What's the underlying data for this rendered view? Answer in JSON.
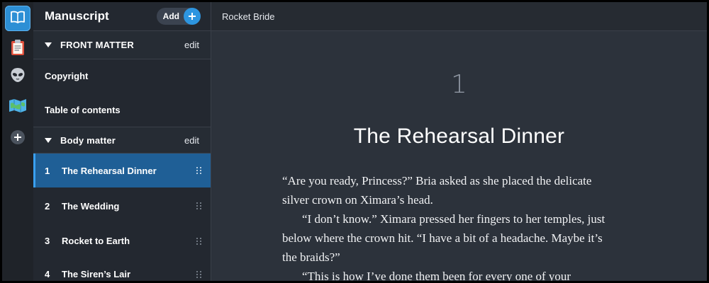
{
  "rail": {
    "items": [
      {
        "icon": "book-icon",
        "active": true
      },
      {
        "icon": "clipboard-icon",
        "active": false
      },
      {
        "icon": "alien-icon",
        "active": false
      },
      {
        "icon": "map-icon",
        "active": false
      },
      {
        "icon": "add-circle-icon",
        "active": false
      }
    ]
  },
  "sidebar": {
    "title": "Manuscript",
    "add_label": "Add",
    "front_matter": {
      "label": "FRONT MATTER",
      "edit": "edit",
      "items": [
        "Copyright",
        "Table of contents"
      ]
    },
    "body_matter": {
      "label": "Body matter",
      "edit": "edit",
      "chapters": [
        {
          "num": "1",
          "title": "The Rehearsal Dinner",
          "active": true
        },
        {
          "num": "2",
          "title": "The Wedding",
          "active": false
        },
        {
          "num": "3",
          "title": "Rocket to Earth",
          "active": false
        },
        {
          "num": "4",
          "title": "The Siren’s Lair",
          "active": false
        }
      ]
    }
  },
  "topbar": {
    "book_title": "Rocket Bride"
  },
  "editor": {
    "chapter_number": "1",
    "chapter_title": "The Rehearsal Dinner",
    "paragraphs": [
      "“Are you ready, Princess?” Bria asked as she placed the delicate silver crown on Ximara’s head.",
      "“I don’t know.” Ximara pressed her fingers to her temples, just below where the crown hit. “I have a bit of a headache. Maybe it’s the braids?”",
      "“This is how I’ve done them been for every one of your"
    ]
  },
  "colors": {
    "accent": "#2d95e0",
    "active_row": "#1f5f96",
    "background": "#2c323b"
  }
}
